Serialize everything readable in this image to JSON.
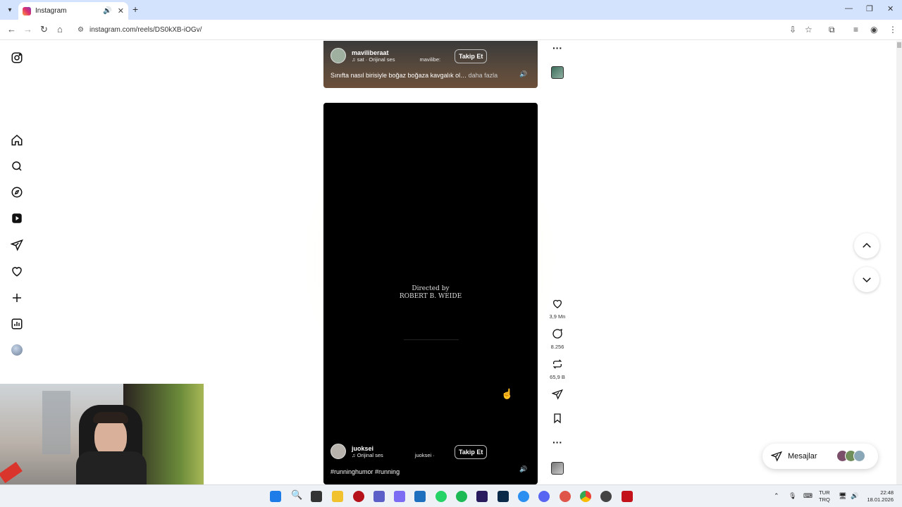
{
  "browser": {
    "tab_title": "Instagram",
    "url": "instagram.com/reels/DS0kXB-iOGv/"
  },
  "reel_top": {
    "username": "maviliberaat",
    "audio": "♫ sat · Orijinal ses",
    "collab": "mavilibe:",
    "follow": "Takip Et",
    "caption": "Sınıfta nasıl birisiyle boğaz boğaza kavgalık ol… ",
    "more": "daha fazla"
  },
  "reel_main": {
    "credit_line1": "Directed by",
    "credit_line2": "ROBERT B. WEIDE",
    "username": "juoksei",
    "audio": "♫ Orijinal ses",
    "collab": "juoksei ·",
    "follow": "Takip Et",
    "hashtags": "#runninghumor #running"
  },
  "actions": {
    "likes": "3,9 Mn",
    "comments": "8.256",
    "reposts": "65,9 B"
  },
  "messages": {
    "label": "Mesajlar"
  },
  "tray": {
    "lang1": "TUR",
    "lang2": "TRQ",
    "time": "22:48",
    "date": "18.01.2026"
  },
  "colors": {
    "tabstrip": "#d3e3fd",
    "accent": "#0095f6"
  }
}
